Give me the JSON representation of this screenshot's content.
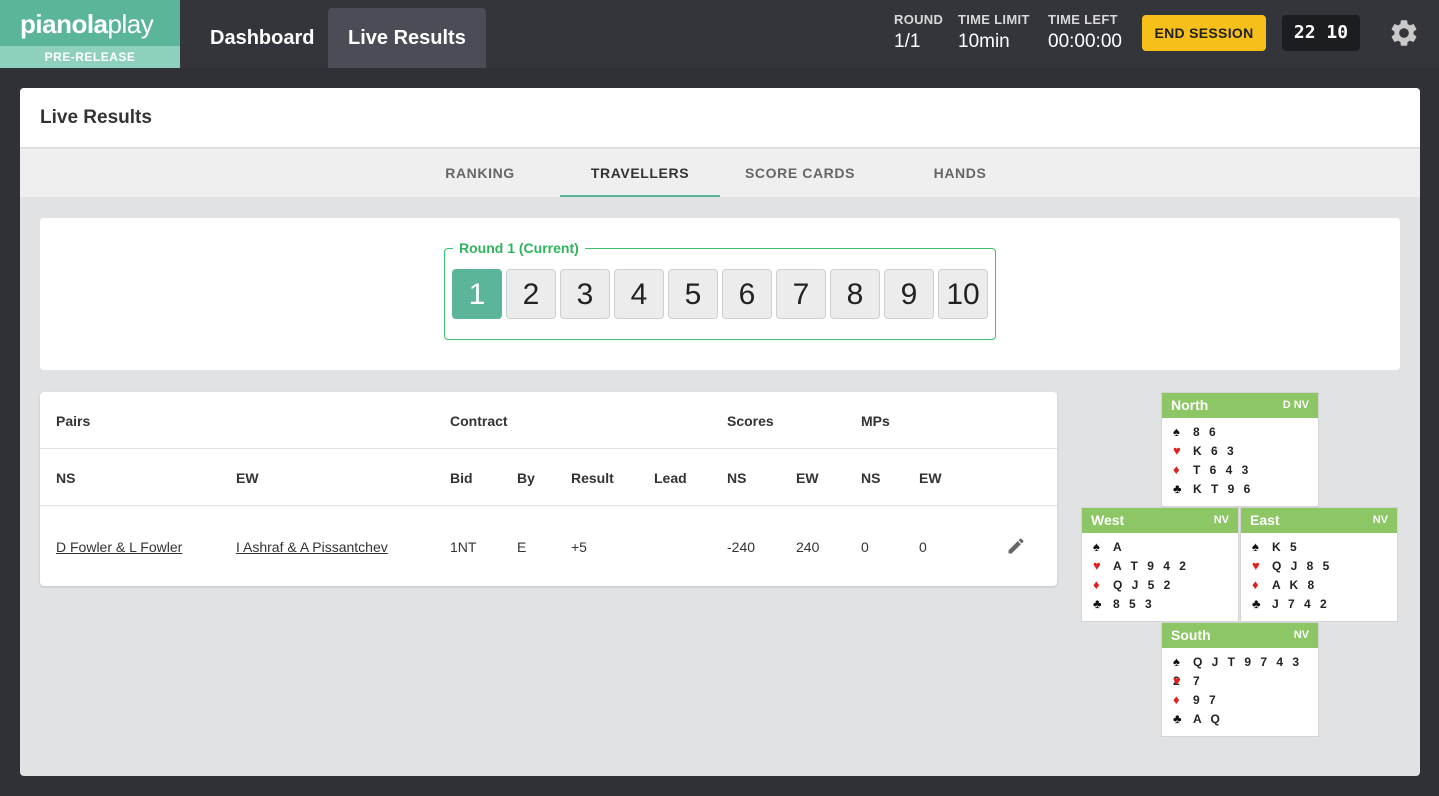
{
  "app": {
    "logo_main": "pianola",
    "logo_accent": "play",
    "badge": "PRE-RELEASE"
  },
  "nav": {
    "dashboard": "Dashboard",
    "live_results": "Live Results"
  },
  "session": {
    "round_label": "ROUND",
    "round_value": "1/1",
    "time_limit_label": "TIME LIMIT",
    "time_limit_value": "10min",
    "time_left_label": "TIME LEFT",
    "time_left_value": "00:00:00",
    "end_button": "END SESSION",
    "clock": "22 10"
  },
  "page": {
    "title": "Live Results",
    "tabs": [
      {
        "label": "RANKING"
      },
      {
        "label": "TRAVELLERS"
      },
      {
        "label": "SCORE CARDS"
      },
      {
        "label": "HANDS"
      }
    ]
  },
  "rounds": {
    "legend": "Round 1 (Current)",
    "boards": [
      "1",
      "2",
      "3",
      "4",
      "5",
      "6",
      "7",
      "8",
      "9",
      "10"
    ]
  },
  "table": {
    "groups": {
      "pairs": "Pairs",
      "contract": "Contract",
      "scores": "Scores",
      "mps": "MPs"
    },
    "columns": {
      "ns": "NS",
      "ew": "EW",
      "bid": "Bid",
      "by": "By",
      "result": "Result",
      "lead": "Lead",
      "score_ns": "NS",
      "score_ew": "EW",
      "mp_ns": "NS",
      "mp_ew": "EW"
    },
    "rows": [
      {
        "ns": "D Fowler & L Fowler",
        "ew": "I Ashraf & A Pissantchev",
        "bid": "1NT",
        "by": "E",
        "result": "+5",
        "lead": "",
        "score_ns": "-240",
        "score_ew": "240",
        "mp_ns": "0",
        "mp_ew": "0"
      }
    ]
  },
  "hands": {
    "north": {
      "name": "North",
      "tag": "D  NV",
      "spades": "8 6",
      "hearts": "K 6 3",
      "diamonds": "T 6 4 3",
      "clubs": "K T 9 6"
    },
    "west": {
      "name": "West",
      "tag": "NV",
      "spades": "A",
      "hearts": "A T 9 4 2",
      "diamonds": "Q J 5 2",
      "clubs": "8 5 3"
    },
    "east": {
      "name": "East",
      "tag": "NV",
      "spades": "K 5",
      "hearts": "Q J 8 5",
      "diamonds": "A K 8",
      "clubs": "J 7 4 2"
    },
    "south": {
      "name": "South",
      "tag": "NV",
      "spades": "Q J T 9 7 4 3 2",
      "hearts": "7",
      "diamonds": "9 7",
      "clubs": "A Q"
    }
  },
  "colors": {
    "brand": "#5bb59a",
    "accent": "#f6bf1a",
    "hand_header": "#8cc665",
    "round_border": "#3cbf6f"
  }
}
